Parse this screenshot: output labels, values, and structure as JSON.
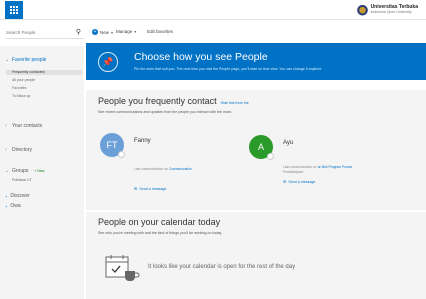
{
  "top_bar": {
    "org_name": "Universitas Terbuka",
    "org_sub": "Indonesia Open University"
  },
  "command_bar": {
    "search_placeholder": "Search People",
    "new_label": "New",
    "manage_label": "Manage",
    "edit_favorites_label": "Edit favorites"
  },
  "sidebar": {
    "favorite_people": "Favorite people",
    "sub_items": [
      "Frequently contacted",
      "All your people",
      "Favorites",
      "To follow up"
    ],
    "your_contacts": "Your contacts",
    "directory": "Directory",
    "groups": "Groups",
    "groups_new": "+ New",
    "groups_item": "Publikasi UT",
    "discover": "Discover",
    "owa": "Owa"
  },
  "banner": {
    "title": "Choose how you see People",
    "text": "Pin the ones that suit you. The next time you visit the People page, you'll start on that view. You can change it anytime."
  },
  "frequent": {
    "title": "People you frequently contact",
    "link": "Hide this from me",
    "desc": "See recent communications and updates from the people you interact with the most.",
    "contacts": [
      {
        "initials": "FT",
        "name": "Fanny",
        "line": "Last communication on",
        "line_link": "Communication",
        "action": "Send a message",
        "color": "#6a9fd8"
      },
      {
        "initials": "A",
        "name": "Ayu",
        "line": "Last communication on",
        "line_link": "ar Ikilo Program Proses",
        "line2": "Pembelajaran",
        "action": "Send a message",
        "color": "#2a9a2a"
      }
    ]
  },
  "calendar": {
    "title": "People on your calendar today",
    "desc": "See who you're meeting with and the kind of things you'll be working on today.",
    "empty_text": "It looks like your calendar is open for the rest of the day"
  },
  "colors": {
    "accent": "#0072c6",
    "sidebar_bg": "#f4f4f4"
  }
}
